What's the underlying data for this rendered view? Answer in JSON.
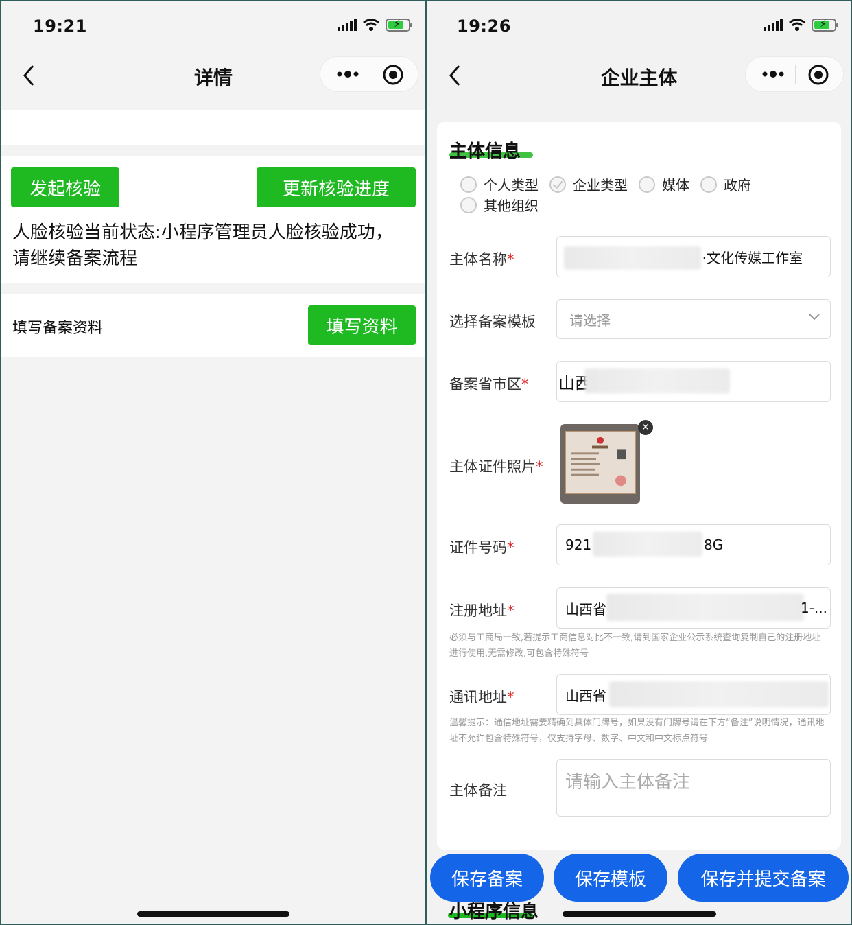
{
  "left": {
    "status": {
      "time": "19:21"
    },
    "nav": {
      "title": "详情"
    },
    "actions": {
      "start_verify": "发起核验",
      "update_progress": "更新核验进度"
    },
    "verify_status": "人脸核验当前状态:小程序管理员人脸核验成功，请继续备案流程",
    "fill_row": {
      "label": "填写备案资料",
      "button": "填写资料"
    }
  },
  "right": {
    "status": {
      "time": "19:26"
    },
    "nav": {
      "title": "企业主体"
    },
    "section_title": "主体信息",
    "subject_types": [
      {
        "label": "个人类型",
        "selected": false
      },
      {
        "label": "企业类型",
        "selected": true
      },
      {
        "label": "媒体",
        "selected": false
      },
      {
        "label": "政府",
        "selected": false
      },
      {
        "label": "其他组织",
        "selected": false
      }
    ],
    "fields": {
      "name": {
        "label": "主体名称",
        "value": "·文化传媒工作室"
      },
      "template": {
        "label": "选择备案模板",
        "placeholder": "请选择"
      },
      "region": {
        "label": "备案省市区",
        "value": "山西"
      },
      "photo": {
        "label": "主体证件照片"
      },
      "cert_no": {
        "label": "证件号码",
        "value_start": "921",
        "value_end": "8G"
      },
      "reg_address": {
        "label": "注册地址",
        "value_start": "山西省",
        "value_end": "1-..."
      },
      "reg_hint": "必须与工商局一致,若提示工商信息对比不一致,请到国家企业公示系统查询复制自己的注册地址进行使用,无需修改,可包含特殊符号",
      "mail_address": {
        "label": "通讯地址",
        "value_start": "山西省"
      },
      "mail_hint": "温馨提示：通信地址需要精确到具体门牌号，如果没有门牌号请在下方“备注”说明情况，通讯地址不允许包含特殊符号，仅支持字母、数字、中文和中文标点符号",
      "remark": {
        "label": "主体备注",
        "placeholder": "请输入主体备注"
      }
    },
    "buttons": {
      "save": "保存备案",
      "save_template": "保存模板",
      "save_submit": "保存并提交备案"
    },
    "next_section": "小程序信息",
    "required_mark": "*"
  },
  "colors": {
    "green": "#1fb922",
    "blue": "#1565e8",
    "required": "#e02020"
  }
}
